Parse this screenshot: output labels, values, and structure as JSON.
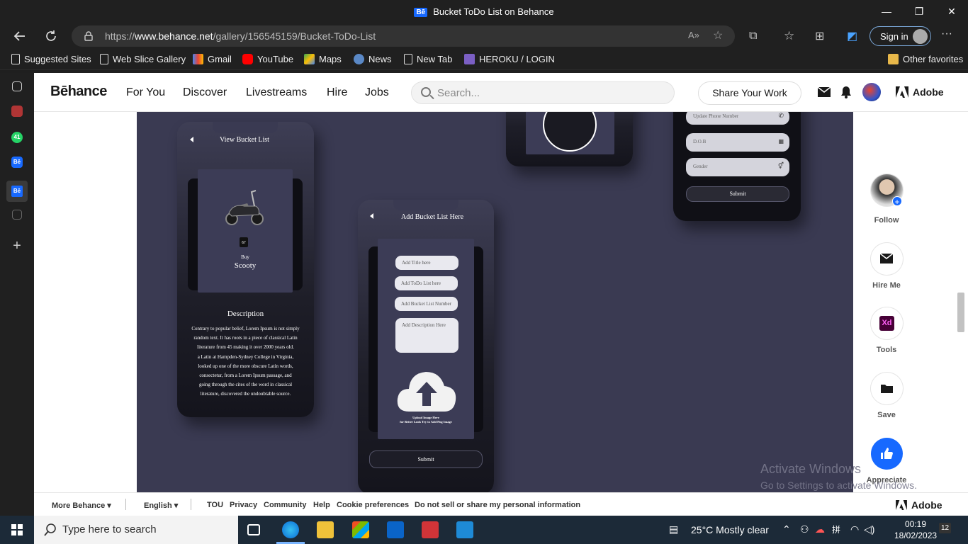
{
  "window": {
    "title": "Bucket ToDo List on Behance",
    "tab_badge": "Bē",
    "minimize": "—",
    "restore": "❐",
    "close": "✕"
  },
  "browser": {
    "url_prefix": "https://",
    "url_domain": "www.behance.net",
    "url_path": "/gallery/156545159/Bucket-ToDo-List",
    "signin_label": "Sign in",
    "more_label": "···"
  },
  "bookmarks": [
    {
      "label": "Suggested Sites"
    },
    {
      "label": "Web Slice Gallery"
    },
    {
      "label": "Gmail"
    },
    {
      "label": "YouTube"
    },
    {
      "label": "Maps"
    },
    {
      "label": "News"
    },
    {
      "label": "New Tab"
    },
    {
      "label": "HEROKU / LOGIN"
    }
  ],
  "other_favorites": "Other favorites",
  "sidebar": {
    "badge_count": "41",
    "be1": "Bē",
    "be2": "Bē"
  },
  "behance": {
    "logo": "Bēhance",
    "nav": [
      "For You",
      "Discover",
      "Livestreams",
      "Hire",
      "Jobs"
    ],
    "search_placeholder": "Search...",
    "share_label": "Share Your Work",
    "adobe_label": "Adobe"
  },
  "project": {
    "phone1": {
      "title": "View Bucket List",
      "price": "67",
      "buy_label": "Buy",
      "item_name": "Scooty",
      "desc_title": "Description",
      "desc_lines": [
        "Contrary to popular belief, Lorem Ipsum is not simply",
        "random text. It has roots in a piece of classical Latin",
        "literature from 45 making it over 2000 years old.",
        "a Latin at Hampden-Sydney College in Virginia,",
        "looked up one of the more obscure Latin words,",
        "consectetur, from a Lorem Ipsum passage, and",
        "going through the cites of the word in classical",
        "literature, discovered the undoubtable source."
      ]
    },
    "phone2": {
      "title": "Add Bucket List Here",
      "field_title": "Add Title here",
      "field_todo": "Add ToDo List here",
      "field_number": "Add Bucket List Number",
      "field_desc": "Add Description Here",
      "upload_line1": "Upload Image Here",
      "upload_line2": "for Better Look Try to Add Png Image",
      "submit": "Submit"
    },
    "phone4": {
      "field_phone": "Update Phone Number",
      "field_dob": "D.O.B",
      "field_gender": "Gender",
      "submit": "Submit"
    }
  },
  "rail": {
    "follow": "Follow",
    "hire_me": "Hire Me",
    "tools": "Tools",
    "tools_icon_text": "Xd",
    "save": "Save",
    "appreciate": "Appreciate"
  },
  "watermark": {
    "line1": "Activate Windows",
    "line2": "Go to Settings to activate Windows."
  },
  "footer": {
    "more_behance": "More Behance ▾",
    "language": "English ▾",
    "links": [
      "TOU",
      "Privacy",
      "Community",
      "Help",
      "Cookie preferences",
      "Do not sell or share my personal information"
    ],
    "adobe": "Adobe"
  },
  "taskbar": {
    "search_placeholder": "Type here to search",
    "weather": "25°C  Mostly clear",
    "time": "00:19",
    "date": "18/02/2023",
    "notifications": "12"
  }
}
